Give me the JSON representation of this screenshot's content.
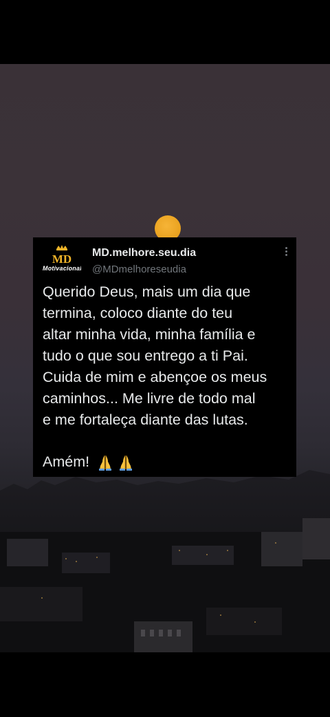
{
  "post": {
    "avatar": {
      "monogram": "MD",
      "caption": "Motivacional",
      "brand_color": "#f0b429"
    },
    "display_name": "MD.melhore.seu.dia",
    "handle": "@MDmelhoreseudia",
    "body": "Querido Deus, mais um dia que\ntermina, coloco diante do teu\naltar minha vida, minha família e\ntudo o que sou entrego a ti Pai.\nCuida de mim e abençoe os meus\ncaminhos... Me livre de todo mal\ne me fortaleça diante das lutas.",
    "closing": "Amém!",
    "closing_emoji": [
      "folded-hands-icon",
      "folded-hands-icon"
    ]
  },
  "colors": {
    "card_background": "#000000",
    "primary_text": "#e7e9ea",
    "secondary_text": "#71767b",
    "moon": "#f0a623",
    "sky": "#3a3137"
  }
}
